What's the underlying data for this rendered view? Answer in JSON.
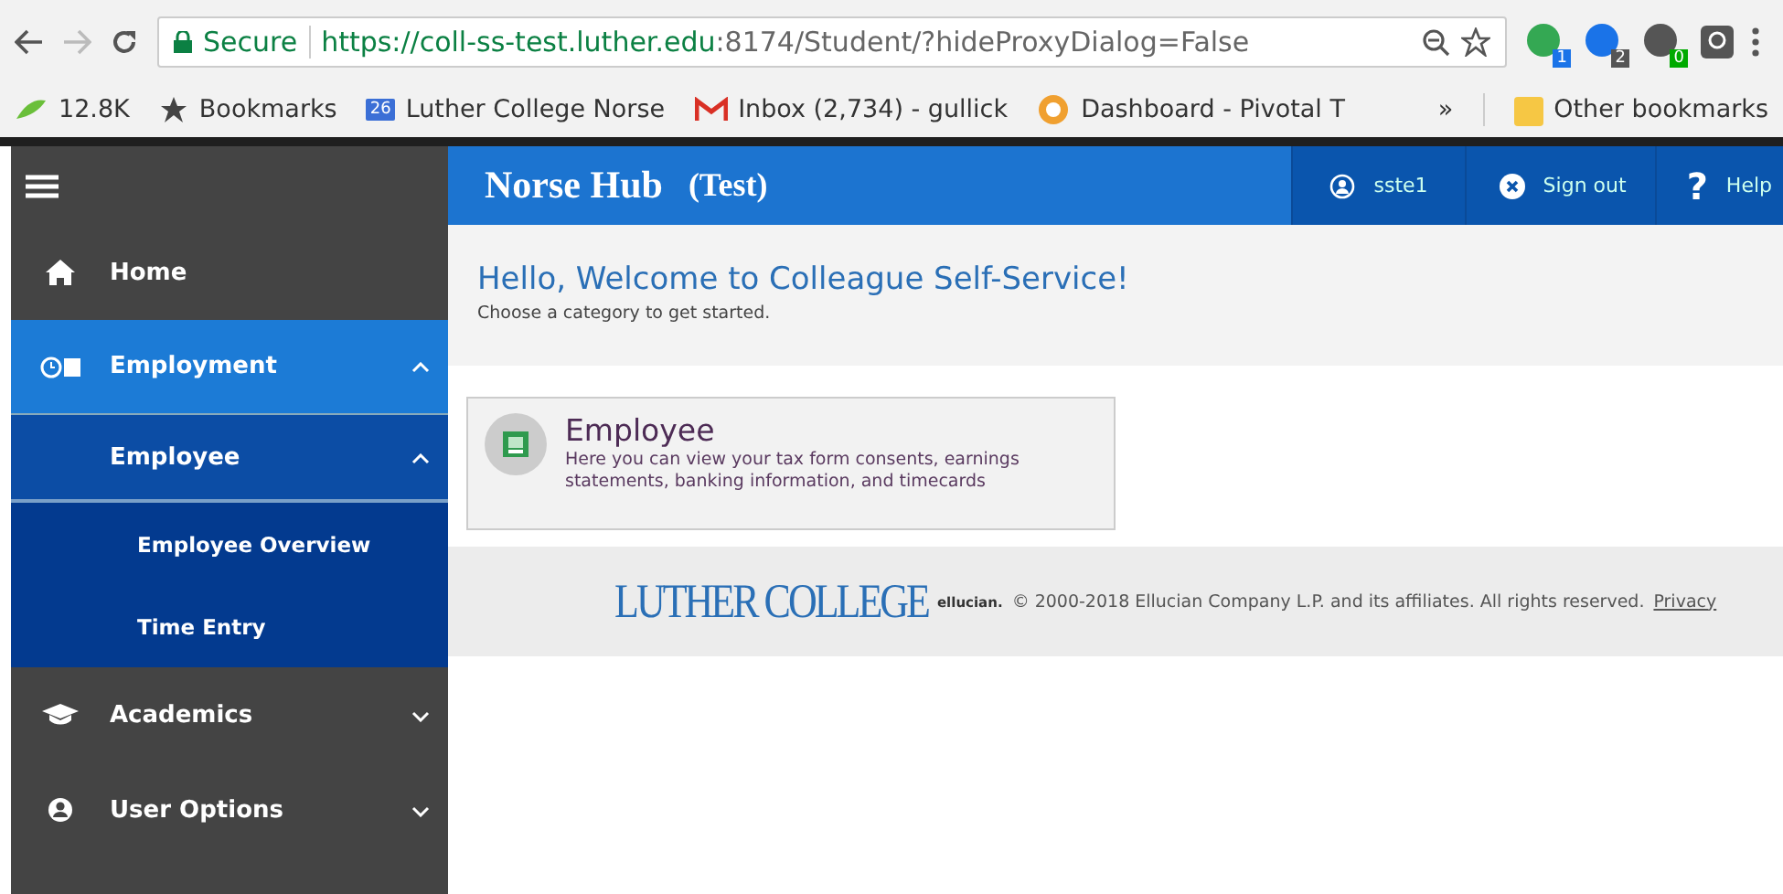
{
  "browser": {
    "secure_label": "Secure",
    "url_host": "https://coll-ss-test.luther.edu",
    "url_path": ":8174/Student/?hideProxyDialog=False",
    "extension_badges": [
      "1",
      "2",
      "0"
    ],
    "bookmarks": [
      {
        "kind": "counter",
        "label": "12.8K"
      },
      {
        "kind": "star",
        "label": "Bookmarks"
      },
      {
        "kind": "calendar",
        "badge": "26",
        "label": "Luther College Norse"
      },
      {
        "kind": "mail",
        "label": "Inbox (2,734) - gullick"
      },
      {
        "kind": "dashboard",
        "label": "Dashboard - Pivotal T"
      }
    ],
    "overflow": "»",
    "other_bookmarks": "Other bookmarks"
  },
  "header": {
    "title": "Norse Hub",
    "subtitle": "(Test)",
    "user": "sste1",
    "sign_out": "Sign out",
    "help_glyph": "?",
    "help": "Help"
  },
  "sidebar": {
    "items": [
      {
        "kind": "home",
        "label": "Home",
        "selected": false
      },
      {
        "kind": "employment",
        "label": "Employment",
        "selected": true,
        "expanded": true,
        "children": [
          {
            "label": "Employee",
            "expanded": true,
            "children": [
              {
                "label": "Employee Overview"
              },
              {
                "label": "Time Entry"
              }
            ]
          }
        ]
      },
      {
        "kind": "academics",
        "label": "Academics",
        "selected": false,
        "expanded": false
      },
      {
        "kind": "user",
        "label": "User Options",
        "selected": false,
        "expanded": false
      }
    ]
  },
  "welcome": {
    "heading": "Hello, Welcome to Colleague Self-Service!",
    "subheading": "Choose a category to get started."
  },
  "categories": [
    {
      "title": "Employee",
      "description": "Here you can view your tax form consents, earnings statements, banking information, and timecards"
    }
  ],
  "footer": {
    "logo": "LUTHER COLLEGE",
    "vendor": "ellucian.",
    "copyright": "© 2000-2018 Ellucian Company L.P. and its affiliates. All rights reserved.",
    "privacy": "Privacy"
  }
}
